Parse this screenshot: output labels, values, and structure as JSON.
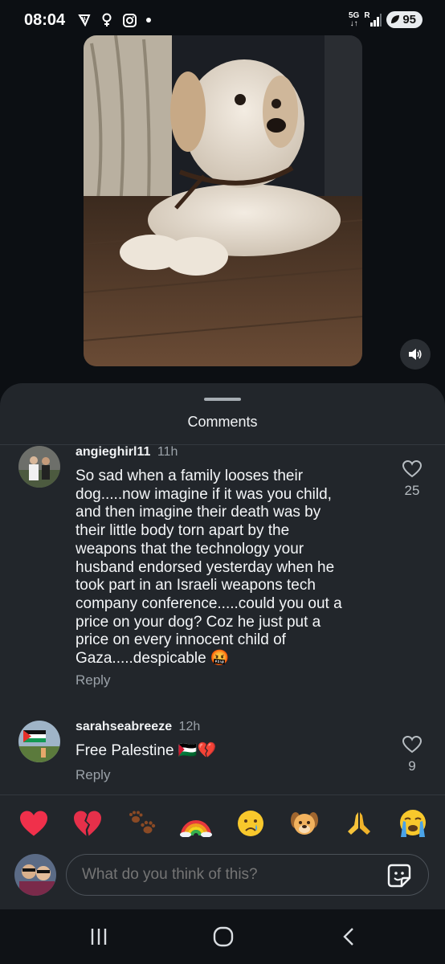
{
  "status_bar": {
    "time": "08:04",
    "network": "5G",
    "roaming": "R",
    "battery": "95"
  },
  "sheet": {
    "title": "Comments"
  },
  "comments": [
    {
      "username": "angieghirl11",
      "time": "11h",
      "text_lines": [
        "So sad when a family looses their",
        "dog.....now imagine if it was you child,",
        "and then imagine their death was by",
        "their little body torn apart by the",
        "weapons that the technology your",
        "husband endorsed yesterday when he",
        "took part in an Israeli weapons tech",
        "company conference.....could you out a",
        "price on your dog? Coz he just put a",
        "price on every innocent child of",
        "Gaza.....despicable 🤬"
      ],
      "reply_label": "Reply",
      "likes": "25"
    },
    {
      "username": "sarahseabreeze",
      "time": "12h",
      "text": "Free Palestine 🇵🇸💔",
      "reply_label": "Reply",
      "likes": "9"
    }
  ],
  "reactions": [
    {
      "icon": "red-heart-icon",
      "emoji": "❤️"
    },
    {
      "icon": "broken-heart-icon",
      "emoji": "💔"
    },
    {
      "icon": "paw-prints-icon",
      "emoji": "🐾"
    },
    {
      "icon": "rainbow-icon",
      "emoji": "🌈"
    },
    {
      "icon": "crying-face-icon",
      "emoji": "😢"
    },
    {
      "icon": "dog-face-icon",
      "emoji": "🐶"
    },
    {
      "icon": "folded-hands-icon",
      "emoji": "🙏"
    },
    {
      "icon": "loudly-crying-face-icon",
      "emoji": "😭"
    }
  ],
  "composer": {
    "placeholder": "What do you think of this?"
  },
  "colors": {
    "background": "#0c0f13",
    "sheet": "#22262b",
    "muted_text": "#9aa1a8",
    "accent_heart": "#e8324a"
  }
}
